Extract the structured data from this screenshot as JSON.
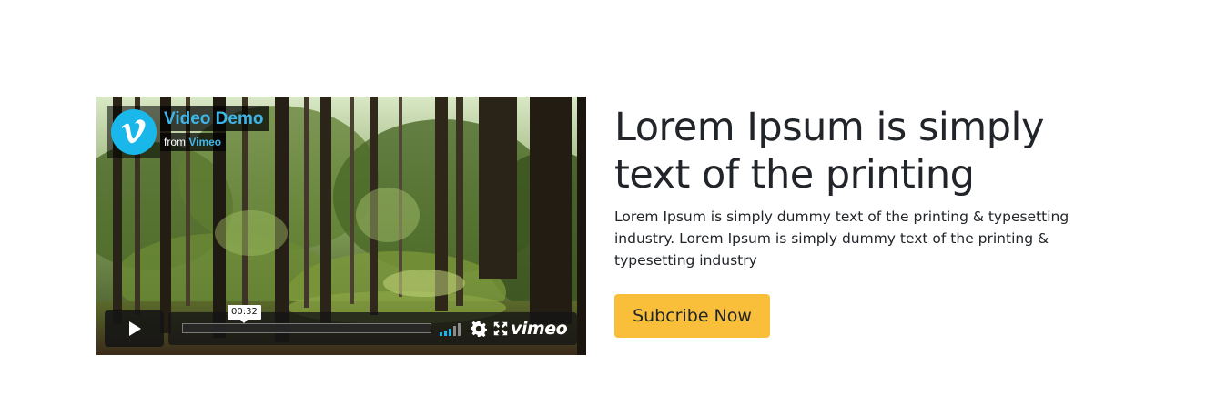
{
  "video": {
    "title": "Video Demo",
    "byline_prefix": "from",
    "byline_owner": "Vimeo",
    "current_time": "00:32",
    "brand": "vimeo",
    "accent_color": "#1ab7ea",
    "icons": {
      "play": "play-icon",
      "volume": "volume-icon",
      "settings": "gear-icon",
      "fullscreen": "fullscreen-icon",
      "logo": "vimeo-logo-icon"
    }
  },
  "content": {
    "heading": "Lorem Ipsum is simply text of the printing",
    "paragraph": "Lorem Ipsum is simply dummy text of the printing & typesetting industry. Lorem Ipsum is simply dummy text of the printing & typesetting industry",
    "cta_label": "Subcribe Now",
    "cta_color": "#f9bf3b"
  }
}
